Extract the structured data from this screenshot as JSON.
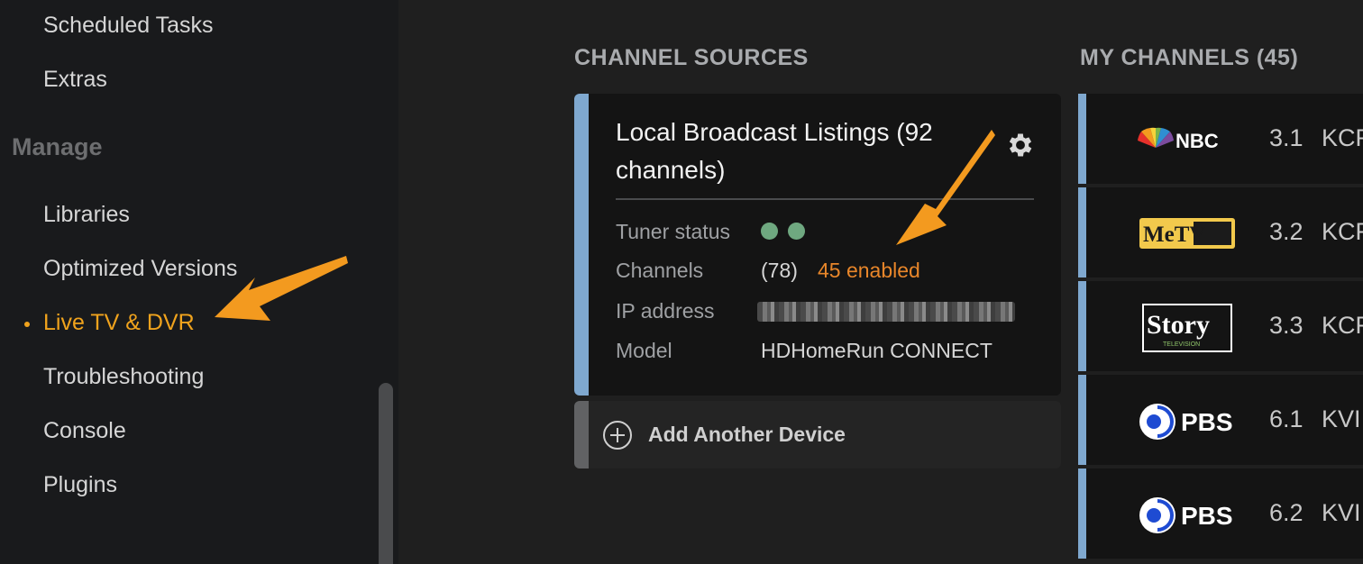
{
  "sidebar": {
    "items_top": [
      "Scheduled Tasks",
      "Extras"
    ],
    "section_title": "Manage",
    "items": [
      "Libraries",
      "Optimized Versions",
      "Live TV & DVR",
      "Troubleshooting",
      "Console",
      "Plugins"
    ],
    "active_item": "Live TV & DVR"
  },
  "channel_sources": {
    "heading": "CHANNEL SOURCES",
    "card": {
      "title": "Local Broadcast Listings (92 channels)",
      "rows": {
        "tuner_status_label": "Tuner status",
        "channels_label": "Channels",
        "channels_total": "(78)",
        "channels_enabled": "45 enabled",
        "ip_label": "IP address",
        "model_label": "Model",
        "model_value": "HDHomeRun CONNECT"
      },
      "tuner_dots": 2
    },
    "add_device_label": "Add Another Device"
  },
  "my_channels": {
    "heading": "MY CHANNELS (45)",
    "channels": [
      {
        "logo": "nbc-logo",
        "logo_text": "NBC",
        "number": "3.1",
        "call": "KCR"
      },
      {
        "logo": "metv-logo",
        "logo_text": "MeTV",
        "number": "3.2",
        "call": "KCR"
      },
      {
        "logo": "story-logo",
        "logo_text": "Story",
        "logo_sub": "TELEVISION",
        "number": "3.3",
        "call": "KCR"
      },
      {
        "logo": "pbs-logo",
        "logo_text": "PBS",
        "number": "6.1",
        "call": "KVI"
      },
      {
        "logo": "pbs-logo",
        "logo_text": "PBS",
        "number": "6.2",
        "call": "KVI"
      }
    ]
  },
  "colors": {
    "accent": "#f0a31d",
    "arrow": "#f39a1f",
    "enabled": "#e8862a",
    "source_bar": "#7fa8cf",
    "tuner_ok": "#6fa880"
  },
  "icons": [
    "gear-icon",
    "plus-circle-icon",
    "annotation-arrow"
  ]
}
